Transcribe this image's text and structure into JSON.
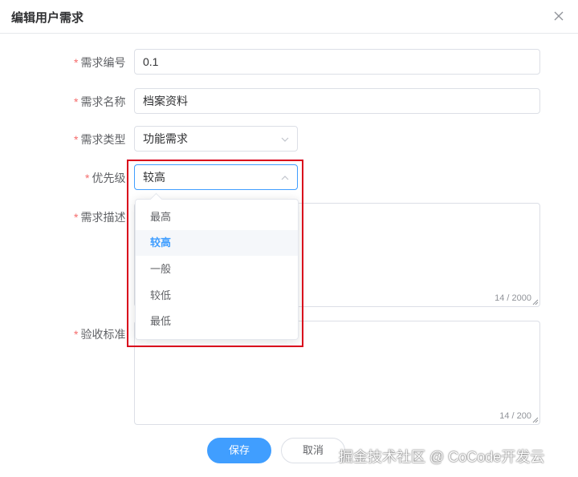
{
  "dialog": {
    "title": "编辑用户需求"
  },
  "form": {
    "number": {
      "label": "需求编号",
      "value": "0.1"
    },
    "name": {
      "label": "需求名称",
      "value": "档案资料"
    },
    "type": {
      "label": "需求类型",
      "value": "功能需求"
    },
    "priority": {
      "label": "优先级",
      "value": "较高"
    },
    "description": {
      "label": "需求描述",
      "counter": "14 / 2000"
    },
    "acceptance": {
      "label": "验收标准",
      "counter": "14 / 200"
    }
  },
  "dropdown": {
    "options": [
      "最高",
      "较高",
      "一般",
      "较低",
      "最低"
    ],
    "selected": "较高"
  },
  "buttons": {
    "save": "保存",
    "cancel": "取消"
  },
  "watermark": "掘金技术社区 @ CoCode开发云",
  "colors": {
    "primary": "#409eff",
    "required": "#f56c6c",
    "highlight": "#d9001b"
  },
  "icons": {
    "close": "close-icon",
    "select_arrow_down": "chevron-down-icon",
    "select_arrow_up": "chevron-up-icon"
  }
}
